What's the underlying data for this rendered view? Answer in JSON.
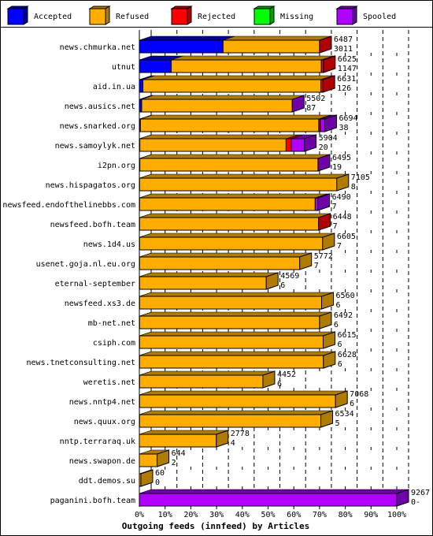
{
  "chart_data": {
    "type": "bar",
    "orientation": "horizontal-stacked-3d",
    "title": "",
    "xlabel": "Outgoing feeds (innfeed) by Articles",
    "ylabel": "",
    "xlim": [
      0,
      100
    ],
    "x_ticks": [
      "0%",
      "10%",
      "20%",
      "30%",
      "40%",
      "50%",
      "60%",
      "70%",
      "80%",
      "90%",
      "100%"
    ],
    "grid": "dashed vertical",
    "legend_position": "top",
    "legend": [
      {
        "name": "Accepted",
        "color": "#0000ff",
        "dark": "#00009c"
      },
      {
        "name": "Refused",
        "color": "#ffae00",
        "dark": "#b07c00"
      },
      {
        "name": "Rejected",
        "color": "#ff0000",
        "dark": "#b00000"
      },
      {
        "name": "Missing",
        "color": "#00ff00",
        "dark": "#00a000"
      },
      {
        "name": "Spooled",
        "color": "#b000ff",
        "dark": "#7000a8"
      }
    ],
    "categories": [
      "news.chmurka.net",
      "utnut",
      "aid.in.ua",
      "news.ausics.net",
      "news.snarked.org",
      "news.samoylyk.net",
      "i2pn.org",
      "news.hispagatos.org",
      "newsfeed.endofthelinebbs.com",
      "newsfeed.bofh.team",
      "news.1d4.us",
      "usenet.goja.nl.eu.org",
      "eternal-september",
      "newsfeed.xs3.de",
      "mb-net.net",
      "csiph.com",
      "news.tnetconsulting.net",
      "weretis.net",
      "news.nntp4.net",
      "news.quux.org",
      "nntp.terraraq.uk",
      "news.swapon.de",
      "ddt.demos.su",
      "paganini.bofh.team"
    ],
    "offered_labels": [
      "6487",
      "6625",
      "6631",
      "5502",
      "6694",
      "5904",
      "6495",
      "7105",
      "6490",
      "6448",
      "6605",
      "5772",
      "4569",
      "6560",
      "6492",
      "6615",
      "6628",
      "4452",
      "7068",
      "6534",
      "2778",
      "644",
      "60",
      "9267"
    ],
    "accepted_labels": [
      "3011",
      "1147",
      "126",
      "87",
      "38",
      "20",
      "19",
      "8",
      "7",
      "7",
      "7",
      "7",
      "6",
      "6",
      "6",
      "6",
      "6",
      "6",
      "6",
      "5",
      "4",
      "2",
      "0",
      "0-"
    ],
    "series": [
      {
        "name": "Accepted",
        "values": [
          32.5,
          12.4,
          1.4,
          0.9,
          0.4,
          0.2,
          0.2,
          0.1,
          0.1,
          0.1,
          0.1,
          0.1,
          0.1,
          0.1,
          0.1,
          0.1,
          0.1,
          0.1,
          0.1,
          0.1,
          0.0,
          0.0,
          0.0,
          0.0
        ]
      },
      {
        "name": "Refused",
        "values": [
          37.5,
          58.3,
          69.1,
          58.5,
          69.3,
          56.8,
          69.2,
          76.6,
          68.2,
          69.5,
          71.1,
          62.2,
          49.2,
          70.7,
          69.9,
          71.3,
          71.4,
          47.9,
          76.1,
          70.4,
          29.9,
          6.9,
          0.6,
          0.0
        ]
      },
      {
        "name": "Rejected",
        "values": [
          0.0,
          0.8,
          0.8,
          0.0,
          0.6,
          2.0,
          0.0,
          0.0,
          0.0,
          0.0,
          0.0,
          0.0,
          0.0,
          0.0,
          0.0,
          0.0,
          0.0,
          0.0,
          0.0,
          0.0,
          0.0,
          0.0,
          0.0,
          0.0
        ]
      },
      {
        "name": "Missing",
        "values": [
          0,
          0,
          0,
          0,
          0,
          0,
          0,
          0,
          0,
          0,
          0,
          0,
          0,
          0,
          0,
          0,
          0,
          0,
          0,
          0,
          0,
          0,
          0,
          0
        ]
      },
      {
        "name": "Spooled",
        "values": [
          0.0,
          0.0,
          0.0,
          0.0,
          1.7,
          5.1,
          0.0,
          0.0,
          1.0,
          0.0,
          0.0,
          0.0,
          0.0,
          0.0,
          0.0,
          0.0,
          0.0,
          0.0,
          0.0,
          0.0,
          0.0,
          0.0,
          0.0,
          100.0
        ]
      }
    ],
    "end_cap_series": [
      "Rejected",
      "Rejected",
      "Rejected",
      "Spooled",
      "Spooled",
      "Spooled",
      "Spooled",
      "Refused",
      "Spooled",
      "Rejected",
      "Refused",
      "Refused",
      "Refused",
      "Refused",
      "Refused",
      "Refused",
      "Refused",
      "Refused",
      "Refused",
      "Refused",
      "Refused",
      "Refused",
      "Refused",
      "Spooled"
    ]
  }
}
